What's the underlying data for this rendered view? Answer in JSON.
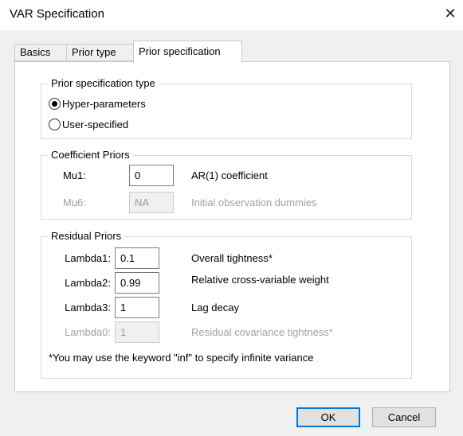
{
  "window": {
    "title": "VAR Specification",
    "close_glyph": "✕"
  },
  "tabs": [
    {
      "label": "Basics"
    },
    {
      "label": "Prior type"
    },
    {
      "label": "Prior specification"
    }
  ],
  "prior_spec_type": {
    "label": "Prior specification type",
    "options": [
      {
        "label": "Hyper-parameters",
        "checked": true
      },
      {
        "label": "User-specified",
        "checked": false
      }
    ]
  },
  "coefficient_priors": {
    "label": "Coefficient Priors",
    "rows": [
      {
        "name": "Mu1:",
        "value": "0",
        "desc": "AR(1) coefficient",
        "enabled": true
      },
      {
        "name": "Mu6:",
        "value": "NA",
        "desc": "Initial observation dummies",
        "enabled": false
      }
    ]
  },
  "residual_priors": {
    "label": "Residual Priors",
    "rows": [
      {
        "name": "Lambda1:",
        "value": "0.1",
        "desc": "Overall tightness*",
        "enabled": true
      },
      {
        "name": "Lambda2:",
        "value": "0.99",
        "desc": "Relative cross-variable weight",
        "enabled": true
      },
      {
        "name": "Lambda3:",
        "value": "1",
        "desc": "Lag decay",
        "enabled": true
      },
      {
        "name": "Lambda0:",
        "value": "1",
        "desc": "Residual covariance tightness*",
        "enabled": false
      }
    ],
    "note": "*You may use the keyword \"inf\" to specify infinite variance"
  },
  "buttons": {
    "ok": "OK",
    "cancel": "Cancel"
  },
  "colors": {
    "default_button_border": "#0078d7",
    "disabled_text": "#a0a0a0"
  }
}
